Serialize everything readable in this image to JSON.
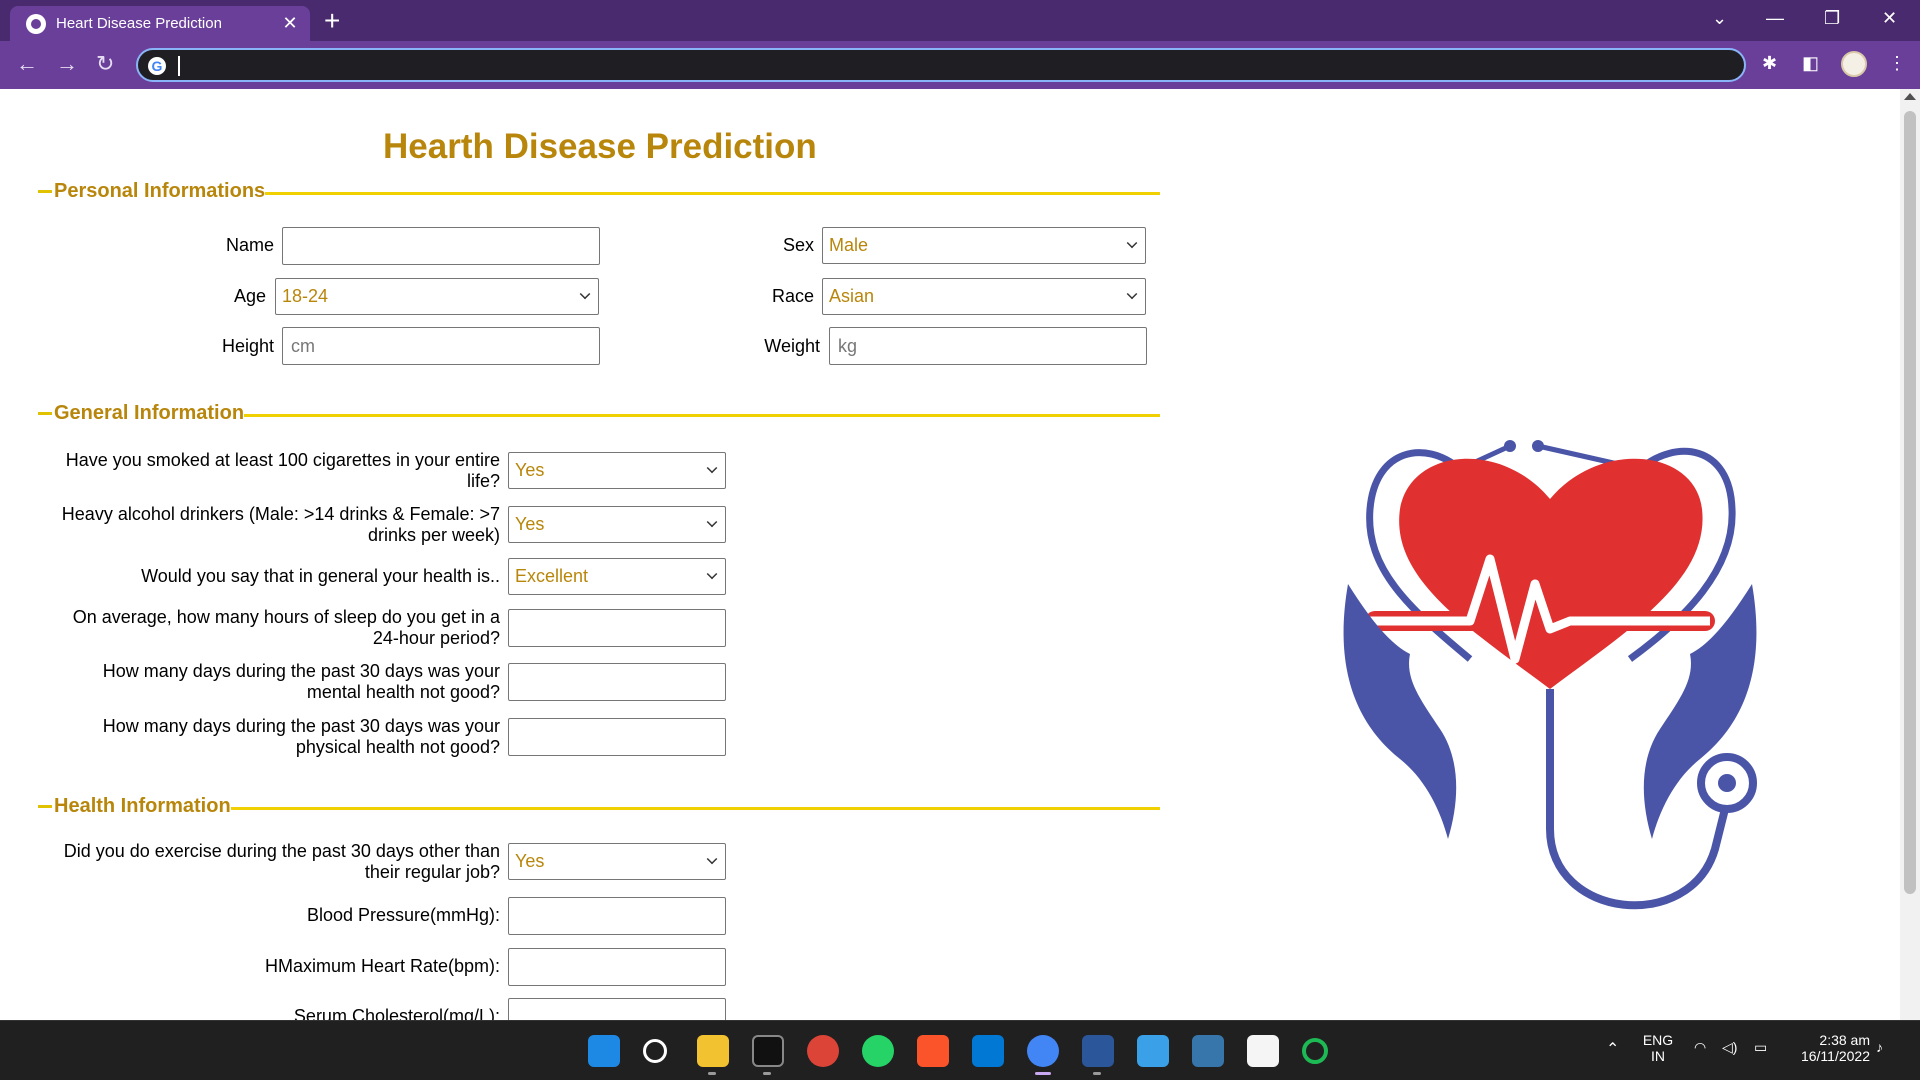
{
  "browser": {
    "tab_title": "Heart Disease Prediction",
    "tab_close": "✕",
    "new_tab": "+",
    "address_value": ""
  },
  "page": {
    "title": "Hearth Disease Prediction",
    "sections": {
      "personal": "Personal Informations",
      "general": "General Information",
      "health": "Health Information"
    },
    "personal": {
      "name_label": "Name",
      "name_value": "",
      "sex_label": "Sex",
      "sex_value": "Male",
      "age_label": "Age",
      "age_value": "18-24",
      "race_label": "Race",
      "race_value": "Asian",
      "height_label": "Height",
      "height_placeholder": "cm",
      "weight_label": "Weight",
      "weight_placeholder": "kg"
    },
    "general": {
      "smoked_label_1": "Have you smoked at least 100 cigarettes in your entire",
      "smoked_label_2": "life?",
      "smoked_value": "Yes",
      "alcohol_label_1": "Heavy alcohol drinkers (Male: >14 drinks & Female: >7",
      "alcohol_label_2": "drinks per week)",
      "alcohol_value": "Yes",
      "health_label": "Would you say that in general your health is..",
      "health_value": "Excellent",
      "sleep_label_1": "On average, how many hours of sleep do you get in a",
      "sleep_label_2": "24-hour period?",
      "mental_label_1": "How many days during the past 30 days was your",
      "mental_label_2": "mental health not good?",
      "physical_label_1": "How many days during the past 30 days was your",
      "physical_label_2": "physical health not good?"
    },
    "health": {
      "exercise_label_1": "Did you do exercise during the past 30 days other than",
      "exercise_label_2": "their regular job?",
      "exercise_value": "Yes",
      "bp_label": "Blood Pressure(mmHg):",
      "hr_label": "HMaximum Heart Rate(bpm):",
      "chol_label": "Serum Cholesterol(mg/L):"
    }
  },
  "taskbar": {
    "lang_1": "ENG",
    "lang_2": "IN",
    "time": "2:38 am",
    "date": "16/11/2022"
  },
  "colors": {
    "accent_gold": "#b8860b",
    "rule_yellow": "#f0d000",
    "chrome_purple": "#6a3f9a",
    "logo_red": "#e03030",
    "logo_blue": "#4a55a8"
  }
}
